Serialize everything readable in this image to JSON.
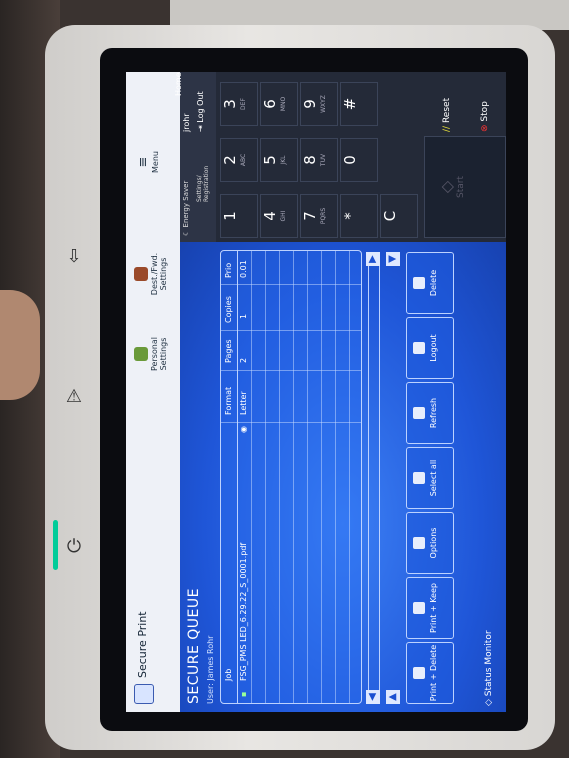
{
  "titlebar": {
    "app_title": "Secure Print",
    "items": [
      {
        "label": "Personal\nSettings"
      },
      {
        "label": "Dest./Fwd.\nSettings"
      },
      {
        "label": "Menu"
      }
    ],
    "energy_saver": "Energy Saver",
    "user": "jrohr",
    "log_out": "Log Out",
    "settings_registration": "Settings/\nRegistration",
    "home": "Home"
  },
  "queue": {
    "title": "SECURE QUEUE",
    "user": "User: James Rohr",
    "columns": [
      "Job",
      "Format",
      "Pages",
      "Copies",
      "Prio"
    ],
    "rows": [
      {
        "job": "FSG_PMS LED_6.29.22_S_0001.pdf",
        "format": "Letter",
        "pages": "2",
        "copies": "1",
        "prio": "0.01"
      }
    ]
  },
  "actions": [
    {
      "label": "Print + Delete"
    },
    {
      "label": "Print + Keep"
    },
    {
      "label": "Options"
    },
    {
      "label": "Select all"
    },
    {
      "label": "Refresh"
    },
    {
      "label": "Logout"
    },
    {
      "label": "Delete"
    }
  ],
  "status_monitor": "Status Monitor",
  "keypad": [
    {
      "k": "1",
      "s": ""
    },
    {
      "k": "2",
      "s": "ABC"
    },
    {
      "k": "3",
      "s": "DEF"
    },
    {
      "k": "4",
      "s": "GHI"
    },
    {
      "k": "5",
      "s": "JKL"
    },
    {
      "k": "6",
      "s": "MNO"
    },
    {
      "k": "7",
      "s": "PQRS"
    },
    {
      "k": "8",
      "s": "TUV"
    },
    {
      "k": "9",
      "s": "WXYZ"
    },
    {
      "k": "*",
      "s": ""
    },
    {
      "k": "0",
      "s": ""
    },
    {
      "k": "#",
      "s": ""
    }
  ],
  "clear_key": "C",
  "start": "Start",
  "stop": "Stop",
  "reset": "Reset"
}
